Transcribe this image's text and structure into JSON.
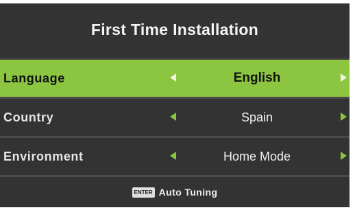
{
  "title": "First Time Installation",
  "rows": [
    {
      "label": "Language",
      "value": "English",
      "selected": true
    },
    {
      "label": "Country",
      "value": "Spain",
      "selected": false
    },
    {
      "label": "Environment",
      "value": "Home Mode",
      "selected": false
    }
  ],
  "footer": {
    "key_label": "ENTER",
    "action": "Auto Tuning"
  },
  "colors": {
    "highlight": "#8cc540",
    "background": "#333333",
    "text": "#f2f2f2"
  },
  "icons": {
    "left": "triangle-left-icon",
    "right": "triangle-right-icon"
  }
}
